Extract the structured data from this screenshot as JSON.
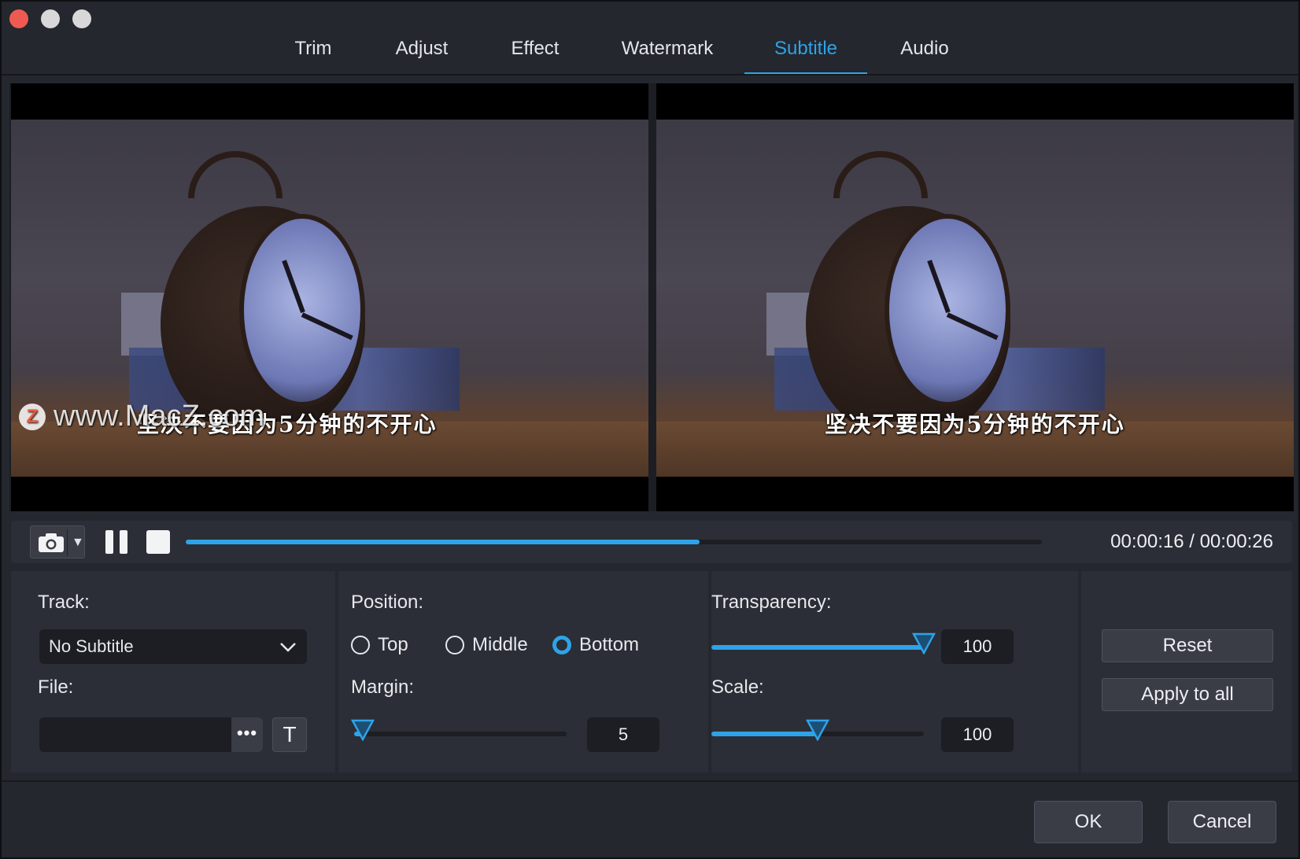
{
  "window": {
    "controls": [
      "close",
      "minimize",
      "zoom"
    ]
  },
  "tabs": [
    {
      "label": "Trim"
    },
    {
      "label": "Adjust"
    },
    {
      "label": "Effect"
    },
    {
      "label": "Watermark"
    },
    {
      "label": "Subtitle",
      "active": true
    },
    {
      "label": "Audio"
    }
  ],
  "preview": {
    "original_subtitle": "坚决不要因为5分钟的不开心",
    "output_subtitle": "坚决不要因为5分钟的不开心",
    "watermark_text": "www.MacZ.com",
    "watermark_badge": "Z"
  },
  "playback": {
    "snapshot_icon": "camera-icon",
    "snapshot_dropdown": "▼",
    "progress_fraction": 0.6,
    "current_time": "00:00:16",
    "total_time": "00:00:26",
    "time_separator": " / "
  },
  "subtitle_settings": {
    "track_label": "Track:",
    "track_value": "No Subtitle",
    "file_label": "File:",
    "file_value": "",
    "browse_label": "•••",
    "text_button_label": "T",
    "position_label": "Position:",
    "position_options": [
      "Top",
      "Middle",
      "Bottom"
    ],
    "position_selected": "Bottom",
    "margin_label": "Margin:",
    "margin_value": "5",
    "margin_fraction": 0.04,
    "transparency_label": "Transparency:",
    "transparency_value": "100",
    "transparency_fraction": 1.0,
    "scale_label": "Scale:",
    "scale_value": "100",
    "scale_fraction": 0.5
  },
  "actions": {
    "reset_label": "Reset",
    "apply_all_label": "Apply to all",
    "ok_label": "OK",
    "cancel_label": "Cancel"
  },
  "colors": {
    "accent": "#2ea3e9",
    "close": "#ee5a52",
    "panel": "#2b2e36",
    "background": "#24272e"
  }
}
